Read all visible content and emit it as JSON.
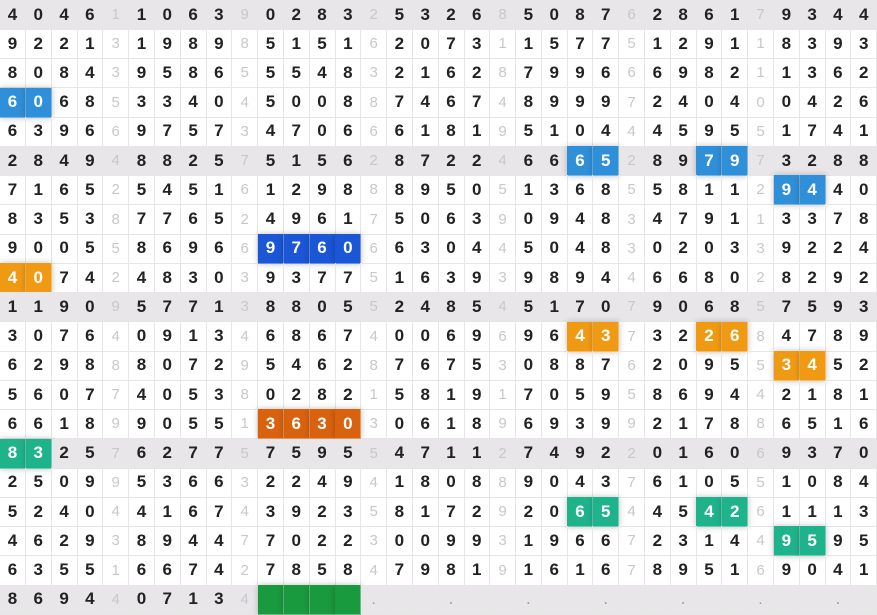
{
  "colors": {
    "shade": "#e9e6ea",
    "blue": "#2f8fd8",
    "darkblue": "#1a56d6",
    "orange": "#f09a14",
    "darkorange": "#d9620e",
    "teal": "#1fb38c",
    "green": "#1a9a3e"
  },
  "grid": {
    "shaded_rows": [
      0,
      5,
      10,
      15,
      20
    ],
    "rows": [
      "4046110639028325326850876286179344",
      "9221319898515162073115775129118393",
      "8084395865554832162879966698211362",
      "6068533404500887467489997240400426",
      "6396697573470666181951044459551741",
      "2849488257515628722466652897973288",
      "7165254516129888950513685581129440",
      "8353877652496175063909483479113378",
      "9005586966976066304450483020339224",
      "4074248303937751639398944668028292",
      "1190957713880552485451707906857593",
      "3076409134686740069696437322684789",
      "6298880729546287675308876209553452",
      "5607740538028215819170595869442181",
      "6618990551363030618969399217886516",
      "8325762775759554711274922016069370",
      "2509953663224941808890437610551084",
      "5240441674392358172920654454261113",
      "4629389447702230099319667231449595",
      "6355166742785847981916167895169041",
      "8694407134    .  .  .  .  .  .  .  "
    ],
    "highlights": [
      {
        "row": 3,
        "col": 0,
        "len": 2,
        "color": "blue"
      },
      {
        "row": 5,
        "col": 22,
        "len": 2,
        "color": "blue"
      },
      {
        "row": 5,
        "col": 27,
        "len": 2,
        "color": "blue"
      },
      {
        "row": 6,
        "col": 30,
        "len": 2,
        "color": "blue"
      },
      {
        "row": 8,
        "col": 10,
        "len": 4,
        "color": "darkblue"
      },
      {
        "row": 9,
        "col": 0,
        "len": 2,
        "color": "orange"
      },
      {
        "row": 11,
        "col": 22,
        "len": 2,
        "color": "orange"
      },
      {
        "row": 11,
        "col": 27,
        "len": 2,
        "color": "orange"
      },
      {
        "row": 12,
        "col": 30,
        "len": 2,
        "color": "orange"
      },
      {
        "row": 14,
        "col": 10,
        "len": 4,
        "color": "darkorange"
      },
      {
        "row": 15,
        "col": 0,
        "len": 2,
        "color": "teal"
      },
      {
        "row": 17,
        "col": 22,
        "len": 2,
        "color": "teal"
      },
      {
        "row": 17,
        "col": 27,
        "len": 2,
        "color": "teal"
      },
      {
        "row": 18,
        "col": 30,
        "len": 2,
        "color": "teal"
      },
      {
        "row": 20,
        "col": 10,
        "len": 4,
        "color": "green"
      }
    ]
  }
}
